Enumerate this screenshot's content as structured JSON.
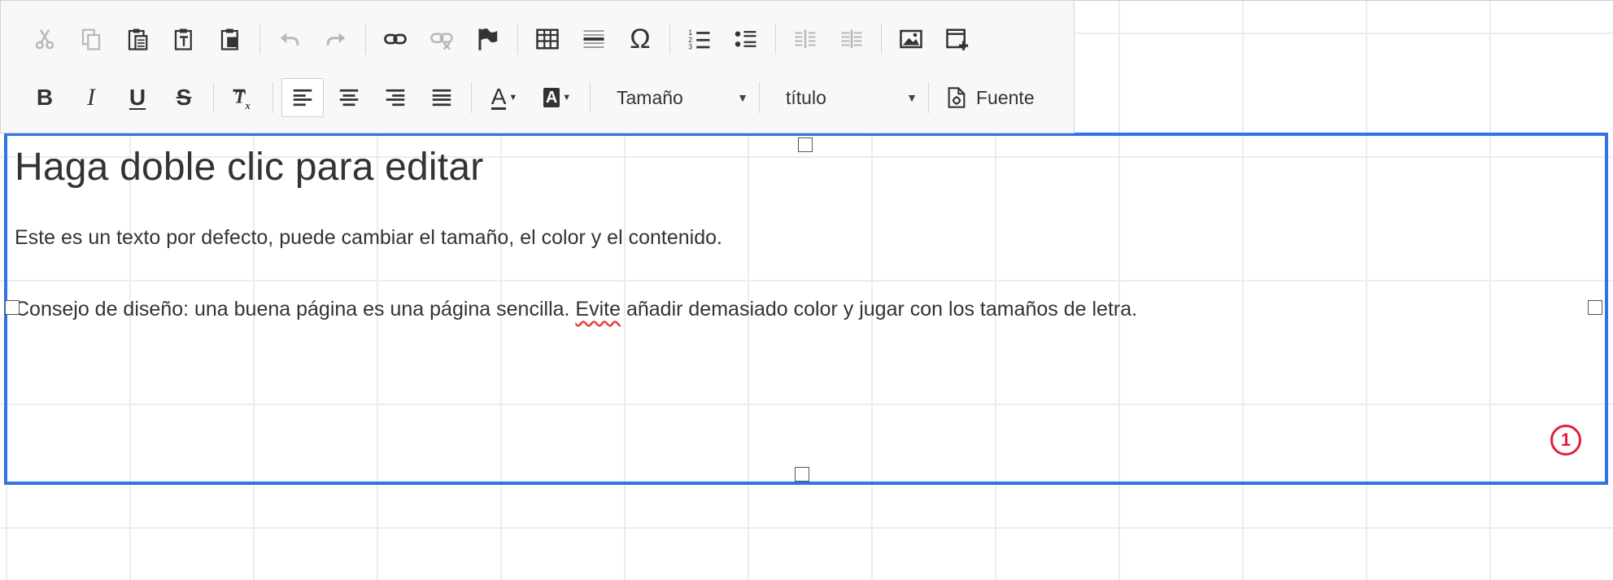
{
  "toolbar": {
    "font_size_combo": {
      "label": "Tamaño"
    },
    "format_combo": {
      "label": "título"
    },
    "source_button": {
      "label": "Fuente"
    },
    "row1_buttons": [
      "cut-icon",
      "copy-icon",
      "paste-icon",
      "paste-text-icon",
      "paste-word-icon",
      "undo-icon",
      "redo-icon",
      "link-icon",
      "unlink-icon",
      "anchor-icon",
      "table-icon",
      "horizontal-line-icon",
      "special-char-icon",
      "numbered-list-icon",
      "bulleted-list-icon",
      "outdent-icon",
      "indent-icon",
      "image-icon",
      "add-widget-icon"
    ],
    "row2_buttons": [
      "bold-icon",
      "italic-icon",
      "underline-icon",
      "strikethrough-icon",
      "remove-format-icon",
      "align-left-icon",
      "align-center-icon",
      "align-right-icon",
      "justify-icon",
      "text-color-icon",
      "background-color-icon"
    ],
    "labels": {
      "bold": "B",
      "italic": "I",
      "underline": "U",
      "strike": "S",
      "text_color": "A",
      "bg_color": "A",
      "special_char": "Ω"
    }
  },
  "content": {
    "heading": "Haga doble clic para editar",
    "paragraph1": "Este es un texto por defecto, puede cambiar el tamaño, el color y el contenido.",
    "paragraph2_before": "Consejo de diseño: una buena página es una página sencilla. ",
    "paragraph2_misspelled": "Evite",
    "paragraph2_after": " añadir demasiado color y jugar con los tamaños de letra."
  },
  "badge": {
    "number": "1"
  },
  "colors": {
    "frame_border": "#2f73e6",
    "badge": "#e51c3c",
    "spellcheck": "#e83a3a"
  }
}
